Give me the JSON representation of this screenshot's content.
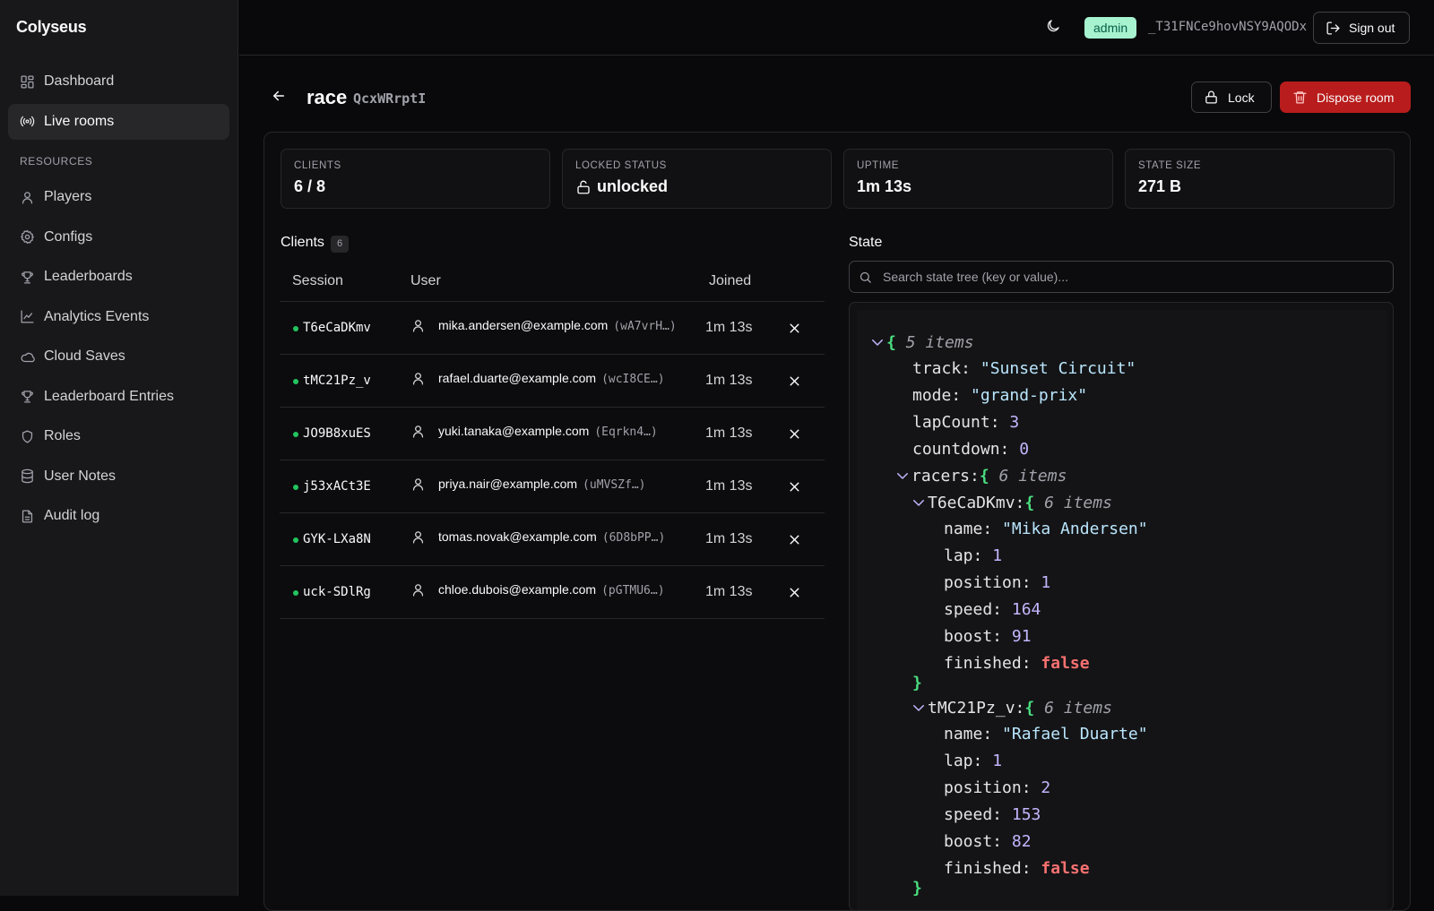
{
  "sidebar": {
    "brand": "Colyseus",
    "items": [
      {
        "label": "Dashboard"
      },
      {
        "label": "Live rooms"
      }
    ],
    "section_label": "RESOURCES",
    "resources": [
      {
        "label": "Players"
      },
      {
        "label": "Configs"
      },
      {
        "label": "Leaderboards"
      },
      {
        "label": "Analytics Events"
      },
      {
        "label": "Cloud Saves"
      },
      {
        "label": "Leaderboard Entries"
      },
      {
        "label": "Roles"
      },
      {
        "label": "User Notes"
      },
      {
        "label": "Audit log"
      }
    ]
  },
  "topbar": {
    "role": "admin",
    "user_id": "_T31FNCe9hovNSY9AQODx",
    "signout_label": "Sign out"
  },
  "room": {
    "name": "race",
    "id": "QcxWRrptI",
    "lock_label": "Lock",
    "dispose_label": "Dispose room"
  },
  "stats": [
    {
      "label": "CLIENTS",
      "value": "6 / 8"
    },
    {
      "label": "LOCKED STATUS",
      "value": "unlocked"
    },
    {
      "label": "UPTIME",
      "value": "1m 13s"
    },
    {
      "label": "STATE SIZE",
      "value": "271 B"
    }
  ],
  "clients": {
    "title": "Clients",
    "count": "6",
    "columns": [
      "Session",
      "User",
      "Joined"
    ],
    "rows": [
      {
        "session": "T6eCaDKmv",
        "email": "mika.andersen@example.com",
        "uid": "(wA7vrH…)",
        "joined": "1m 13s"
      },
      {
        "session": "tMC21Pz_v",
        "email": "rafael.duarte@example.com",
        "uid": "(wcI8CE…)",
        "joined": "1m 13s"
      },
      {
        "session": "JO9B8xuES",
        "email": "yuki.tanaka@example.com",
        "uid": "(Eqrkn4…)",
        "joined": "1m 13s"
      },
      {
        "session": "j53xACt3E",
        "email": "priya.nair@example.com",
        "uid": "(uMVSZf…)",
        "joined": "1m 13s"
      },
      {
        "session": "GYK-LXa8N",
        "email": "tomas.novak@example.com",
        "uid": "(6D8bPP…)",
        "joined": "1m 13s"
      },
      {
        "session": "uck-SDlRg",
        "email": "chloe.dubois@example.com",
        "uid": "(pGTMU6…)",
        "joined": "1m 13s"
      }
    ]
  },
  "state": {
    "title": "State",
    "search_placeholder": "Search state tree (key or value)...",
    "root_count": "5 items",
    "track_key": "track:",
    "track_val": "\"Sunset Circuit\"",
    "mode_key": "mode:",
    "mode_val": "\"grand-prix\"",
    "lapcount_key": "lapCount:",
    "lapcount_val": "3",
    "countdown_key": "countdown:",
    "countdown_val": "0",
    "racers_key": "racers:",
    "racers_count": "6 items",
    "racer1": {
      "key": "T6eCaDKmv:",
      "count": "6 items",
      "name_val": "\"Mika Andersen\"",
      "lap_val": "1",
      "position_val": "1",
      "speed_val": "164",
      "boost_val": "91",
      "finished_val": "false"
    },
    "racer2": {
      "key": "tMC21Pz_v:",
      "count": "6 items",
      "name_val": "\"Rafael Duarte\"",
      "lap_val": "1",
      "position_val": "2",
      "speed_val": "153",
      "boost_val": "82",
      "finished_val": "false"
    },
    "field_keys": {
      "name": "name:",
      "lap": "lap:",
      "position": "position:",
      "speed": "speed:",
      "boost": "boost:",
      "finished": "finished:"
    }
  }
}
